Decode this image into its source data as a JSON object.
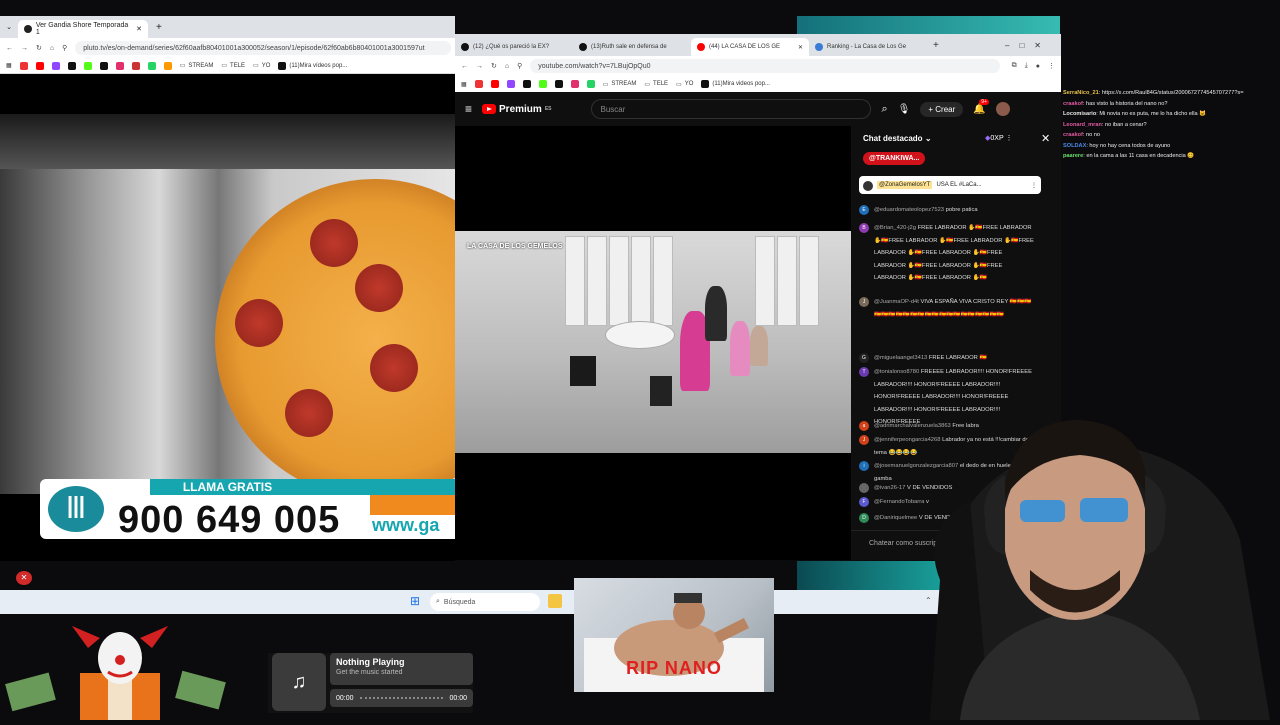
{
  "left_browser": {
    "tab_title": "Ver Gandia Shore Temporada 1",
    "url": "pluto.tv/es/on-demand/series/62f60aafb80401001a300052/season/1/episode/62f60ab6b80401001a3001597ut",
    "bookmarks": [
      "STREAM",
      "TELE",
      "YO",
      "(11)Mira vídeos pop..."
    ]
  },
  "ad_banner": {
    "top_text": "LLAMA GRATIS",
    "phone": "900 649 005",
    "url_partial": "www.ga",
    "logo_glyph": "Ⅲ"
  },
  "right_browser": {
    "tabs": [
      {
        "label": "(12) ¿Qué os pareció la EX?",
        "color": "#111111"
      },
      {
        "label": "(13)Ruth sale en defensa de",
        "color": "#111111"
      },
      {
        "label": "(44) LA CASA DE LOS GE",
        "color": "#ff0000"
      },
      {
        "label": "Ranking - La Casa de Los Ge",
        "color": "#3a7bd5"
      }
    ],
    "url": "youtube.com/watch?v=7LBujOpQu0",
    "bookmarks": [
      "STREAM",
      "TELE",
      "YO",
      "(11)Mira videos pop..."
    ]
  },
  "youtube": {
    "logo": "Premium",
    "logo_sup": "ES",
    "search_placeholder": "Buscar",
    "create_label": "Crear",
    "notif_count": "9+",
    "video_watermark": "LA CASA DE LOS GEMELOS"
  },
  "chat": {
    "header": "Chat destacado",
    "points": "0XP",
    "pinned_user": "@TRANKIWA...",
    "pinned_message_user": "@ZonaGemelosYT",
    "pinned_message_text": "USA EL #LaCa...",
    "messages": [
      {
        "user": "@eduardomateolopez7523",
        "text": "pobre patica",
        "avatar": "E",
        "color": "#1e6fb8"
      },
      {
        "user": "@Brian_420-j2g",
        "text": "FREE LABRADOR ✋🇪🇸FREE LABRADOR ✋🇪🇸FREE LABRADOR ✋🇪🇸FREE LABRADOR ✋🇪🇸FREE LABRADOR ✋🇪🇸FREE LABRADOR ✋🇪🇸FREE LABRADOR ✋🇪🇸FREE LABRADOR ✋🇪🇸FREE LABRADOR ✋🇪🇸FREE LABRADOR ✋🇪🇸",
        "avatar": "B",
        "color": "#8e3bb0"
      },
      {
        "user": "@JuanmaOP-d4t",
        "text": "VIVA ESPAÑA VIVA CRISTO REY 🇪🇸🇪🇸🇪🇸🇪🇸🇪🇸🇪🇸🇪🇸🇪🇸🇪🇸🇪🇸🇪🇸🇪🇸🇪🇸🇪🇸🇪🇸🇪🇸🇪🇸🇪🇸🇪🇸🇪🇸🇪🇸",
        "avatar": "J",
        "color": "#7a6a5a"
      },
      {
        "user": "@miguelaangel3413",
        "text": "FREE LABRADOR 🇪🇸",
        "avatar": "G",
        "color": "#222222"
      },
      {
        "user": "@tonialonso8780",
        "text": "FREEEE LABRADOR!!!! HONOR!FREEEE LABRADOR!!!! HONOR!FREEEE LABRADOR!!!! HONOR!FREEEE LABRADOR!!!! HONOR!FREEEE LABRADOR!!!! HONOR!FREEEE LABRADOR!!!! HONOR!FREEEE",
        "avatar": "T",
        "color": "#6a3bb0"
      },
      {
        "user": "@adrimarchalvalenzuela3863",
        "text": "Free labra",
        "avatar": "a",
        "color": "#d2421a"
      },
      {
        "user": "@jenniferpeongarcia4268",
        "text": "Labrador ya no está !!!cambiar de tema 😂😂😂😂",
        "avatar": "J",
        "color": "#d2421a"
      },
      {
        "user": "@josemanuelgonzalezgarcia807",
        "text": "el dedo de en huele a gamba",
        "avatar": "i",
        "color": "#1e6fb8"
      },
      {
        "user": "@ivan26-17",
        "text": "V DE VENDIDOS",
        "avatar": "",
        "color": "#666666"
      },
      {
        "user": "@FernandoTobarra",
        "text": "v",
        "avatar": "F",
        "color": "#5a5ad0"
      },
      {
        "user": "@Daniriquelmee",
        "text": "V DE VENDIDOS",
        "avatar": "D",
        "color": "#2e8b57"
      }
    ],
    "input_placeholder": "Chatear como suscriptor..."
  },
  "overlay_chat": [
    {
      "name": "SerraNico_21",
      "text": ": https://x.com/Raul84G/status/2000672774545707277?s=",
      "color": "#e8c24a"
    },
    {
      "name": "craakof",
      "text": ": has visto la historia del nano no?",
      "color": "#e05aa0"
    },
    {
      "name": "Locomisario",
      "text": ": Mi novia no es puta, me lo ha dicho ella 🐱",
      "color": "#e8e8e8"
    },
    {
      "name": "Leonard_mran",
      "text": ": no iban a cenar?",
      "color": "#e05aa0"
    },
    {
      "name": "craakof",
      "text": ": no no",
      "color": "#e05aa0"
    },
    {
      "name": "SOLDAX",
      "text": ": hoy no hay cena todos de ayuno",
      "color": "#4a8ae8"
    },
    {
      "name": "paarere",
      "text": ": en la cama a las 11 casa en decadencia 🥴",
      "color": "#6ae06a"
    }
  ],
  "taskbar": {
    "search_placeholder": "Búsqueda"
  },
  "music_widget": {
    "title": "Nothing Playing",
    "subtitle": "Get the music started",
    "time_start": "00:00",
    "time_end": "00:00"
  },
  "rip_image": {
    "caption": "RIP NANO"
  }
}
